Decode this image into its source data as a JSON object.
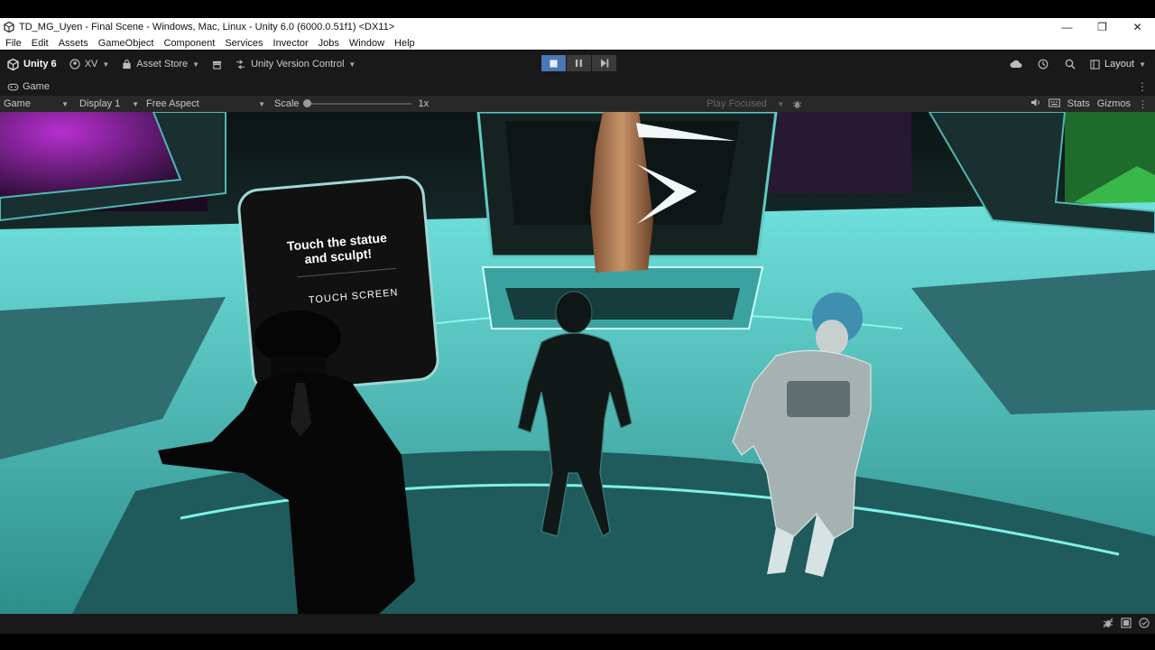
{
  "window": {
    "title": "TD_MG_Uyen - Final Scene - Windows, Mac, Linux - Unity 6.0 (6000.0.51f1) <DX11>",
    "controls": {
      "minimize": "—",
      "restore": "❐",
      "close": "✕"
    }
  },
  "menu": [
    "File",
    "Edit",
    "Assets",
    "GameObject",
    "Component",
    "Services",
    "Invector",
    "Jobs",
    "Window",
    "Help"
  ],
  "toolbar": {
    "product": "Unity 6",
    "account": "XV",
    "asset_store": "Asset Store",
    "version_control": "Unity Version Control",
    "layout": "Layout",
    "icons": {
      "cloud": "cloud-icon",
      "history": "history-icon",
      "search": "search-icon"
    }
  },
  "tab": {
    "label": "Game",
    "icon": "gamepad-icon"
  },
  "game_toolbar": {
    "view_mode": "Game",
    "display": "Display 1",
    "aspect": "Free Aspect",
    "scale_label": "Scale",
    "scale_value": "1x",
    "play_mode": "Play Focused",
    "stats": "Stats",
    "gizmos": "Gizmos"
  },
  "scene": {
    "sign_line1": "Touch the statue",
    "sign_line2": "and sculpt!",
    "sign_button": "TOUCH SCREEN"
  },
  "colors": {
    "accent": "#4a77b6",
    "floor": "#52c9c4",
    "toolbar_bg": "#191919"
  }
}
